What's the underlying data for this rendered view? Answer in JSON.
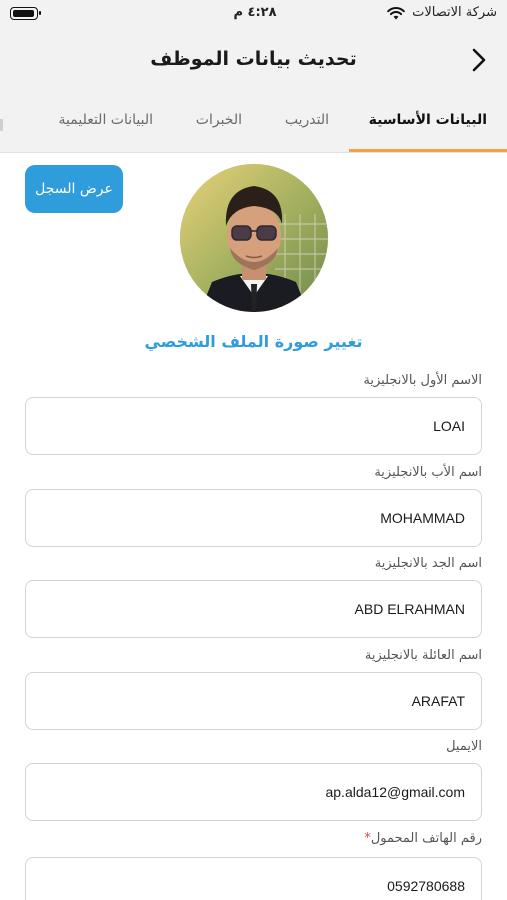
{
  "status_bar": {
    "carrier": "شركة الاتصالات",
    "time": "٤:٢٨ م"
  },
  "header": {
    "title": "تحديث بيانات الموظف",
    "back_icon": "chevron-right-icon"
  },
  "tabs": [
    {
      "label": "البيانات الأساسية",
      "active": true
    },
    {
      "label": "التدريب",
      "active": false
    },
    {
      "label": "الخبرات",
      "active": false
    },
    {
      "label": "البيانات التعليمية",
      "active": false
    }
  ],
  "profile": {
    "history_button": "عرض السجل",
    "change_photo_link": "تغيير صورة الملف الشخصي"
  },
  "fields": [
    {
      "label": "الاسم الأول بالانجليزية",
      "value": "LOAI",
      "required": false
    },
    {
      "label": "اسم الأب بالانجليزية",
      "value": "MOHAMMAD",
      "required": false
    },
    {
      "label": "اسم الجد بالانجليزية",
      "value": "ABD ELRAHMAN",
      "required": false
    },
    {
      "label": "اسم العائلة بالانجليزية",
      "value": "ARAFAT",
      "required": false
    },
    {
      "label": "الايميل",
      "value": "ap.alda12@gmail.com",
      "required": false
    },
    {
      "label": "رقم الهاتف المحمول",
      "value": "0592780688",
      "required": true,
      "required_mark": "*"
    }
  ],
  "colors": {
    "accent_blue": "#2f9ddc",
    "tab_underline": "#f0a347",
    "header_bg": "#f2f2f2",
    "required": "#e04848"
  }
}
